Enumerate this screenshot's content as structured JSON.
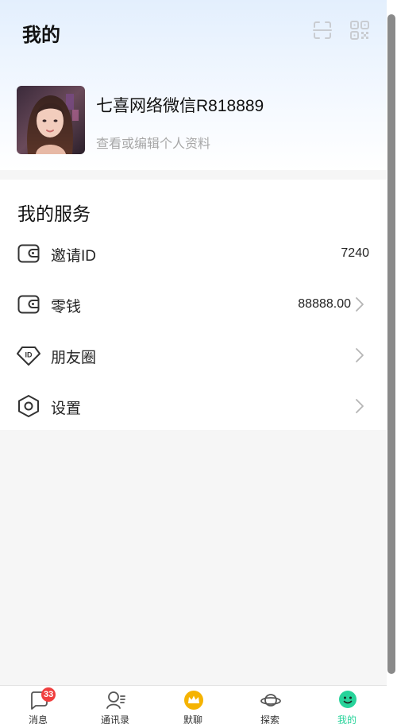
{
  "header": {
    "title": "我的",
    "scan_icon": "scan-icon",
    "qr_icon": "qr-code-icon"
  },
  "profile": {
    "name": "七喜网络微信R818889",
    "subtitle": "查看或编辑个人资料"
  },
  "services": {
    "title": "我的服务",
    "items": [
      {
        "label": "邀请ID",
        "value": "7240",
        "icon": "wallet-icon"
      },
      {
        "label": "零钱",
        "value": "88888.00",
        "icon": "wallet-icon"
      },
      {
        "label": "朋友圈",
        "value": "",
        "icon": "id-badge-icon"
      },
      {
        "label": "设置",
        "value": "",
        "icon": "hexagon-settings-icon"
      }
    ]
  },
  "tabbar": {
    "tabs": [
      {
        "label": "消息",
        "icon": "chat-bubble-icon",
        "badge": "33"
      },
      {
        "label": "通讯录",
        "icon": "contacts-icon"
      },
      {
        "label": "默聊",
        "icon": "crown-icon"
      },
      {
        "label": "探索",
        "icon": "planet-icon"
      },
      {
        "label": "我的",
        "icon": "smiley-face-icon",
        "active": true
      }
    ]
  },
  "colors": {
    "accent": "#27d39a",
    "badge": "#f03e3e",
    "header_gradient_top": "#e3effd",
    "crown": "#f5b301"
  }
}
